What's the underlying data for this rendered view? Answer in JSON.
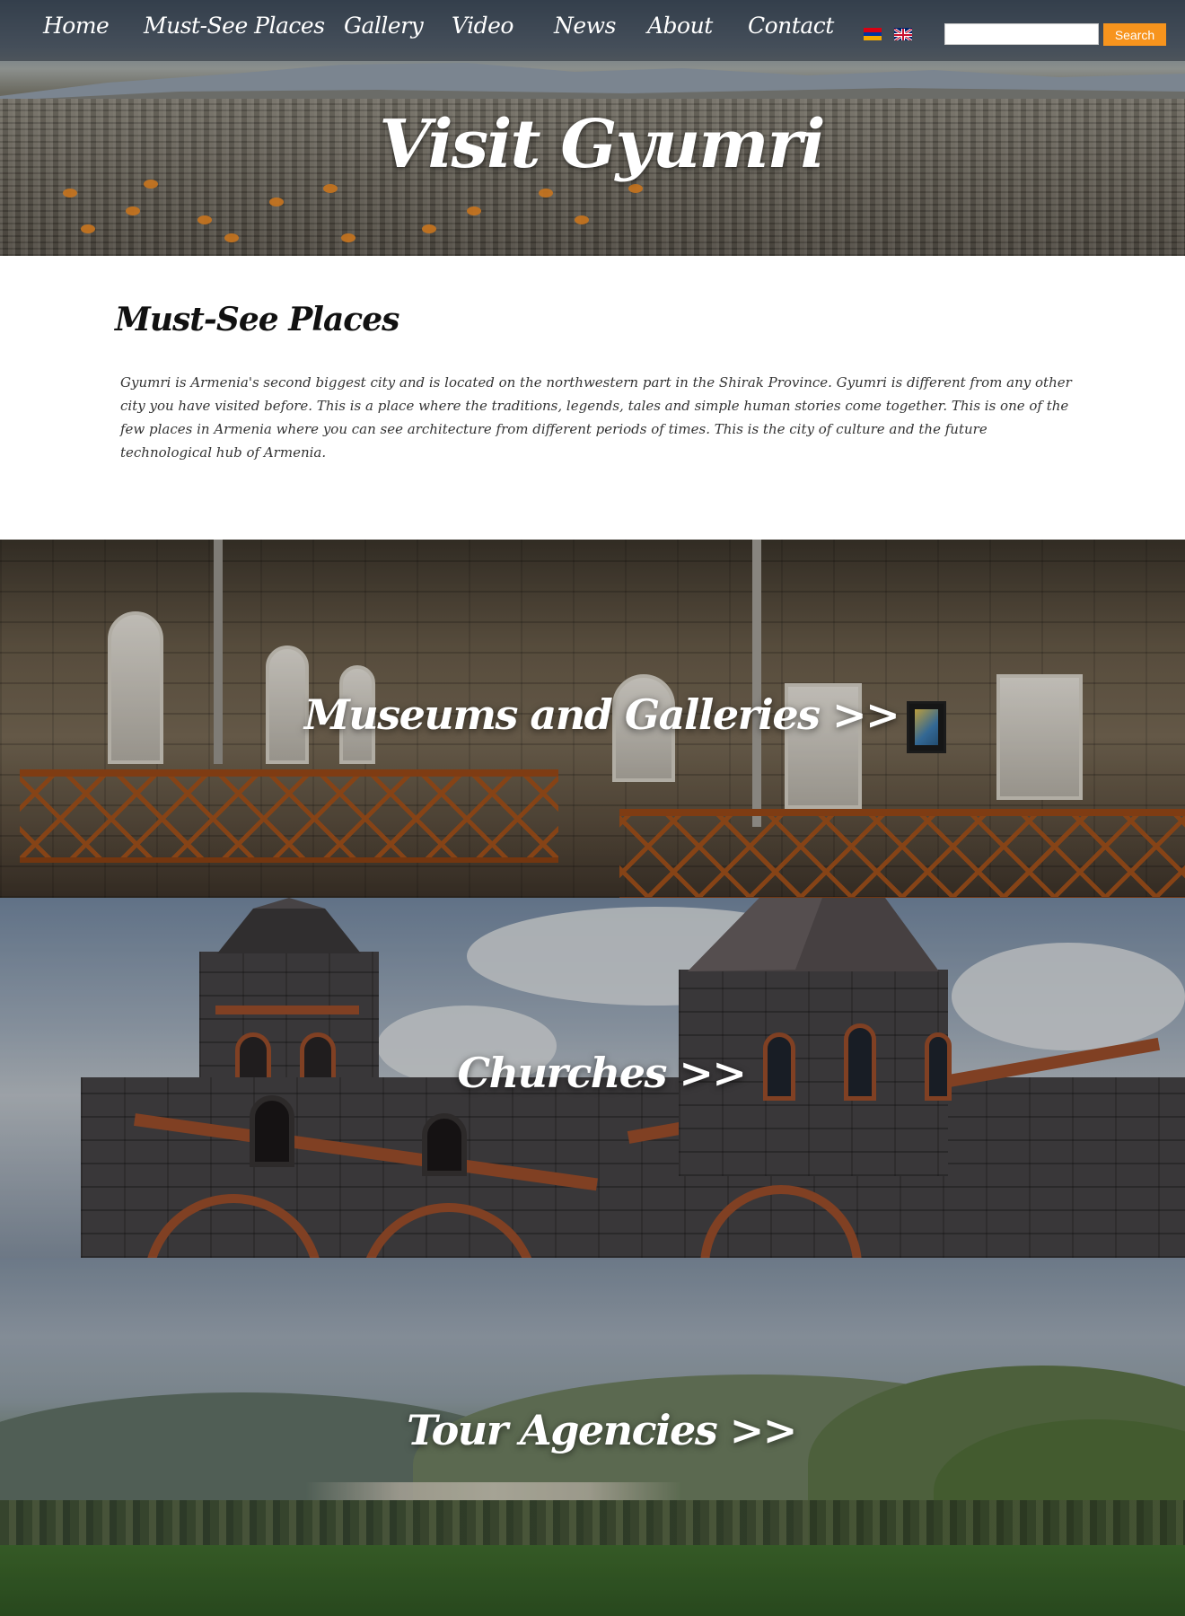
{
  "nav": {
    "items": [
      {
        "label": "Home"
      },
      {
        "label": "Must-See Places"
      },
      {
        "label": "Gallery"
      },
      {
        "label": "Video"
      },
      {
        "label": "News"
      },
      {
        "label": "About"
      },
      {
        "label": "Contact"
      }
    ],
    "languages": [
      {
        "icon": "armenian-flag-icon"
      },
      {
        "icon": "uk-flag-icon"
      }
    ],
    "search": {
      "value": "",
      "placeholder": "",
      "button_label": "Search"
    }
  },
  "hero": {
    "title": "Visit Gyumri"
  },
  "intro": {
    "heading": "Must-See Places",
    "text": "Gyumri is Armenia's second biggest city and is located on the northwestern part in the Shirak Province. Gyumri is different from any other city you have visited before. This is a place where the traditions, legends, tales and simple human stories come together. This is one of the few places in Armenia where you can see architecture from different periods of times. This is the city of culture and the future technological hub of Armenia."
  },
  "categories": [
    {
      "label": "Museums and Galleries >>"
    },
    {
      "label": "Churches >>"
    },
    {
      "label": "Tour Agencies >>"
    }
  ],
  "colors": {
    "accent": "#f7941d",
    "nav_text": "#ffffff",
    "heading_text": "#111111"
  }
}
